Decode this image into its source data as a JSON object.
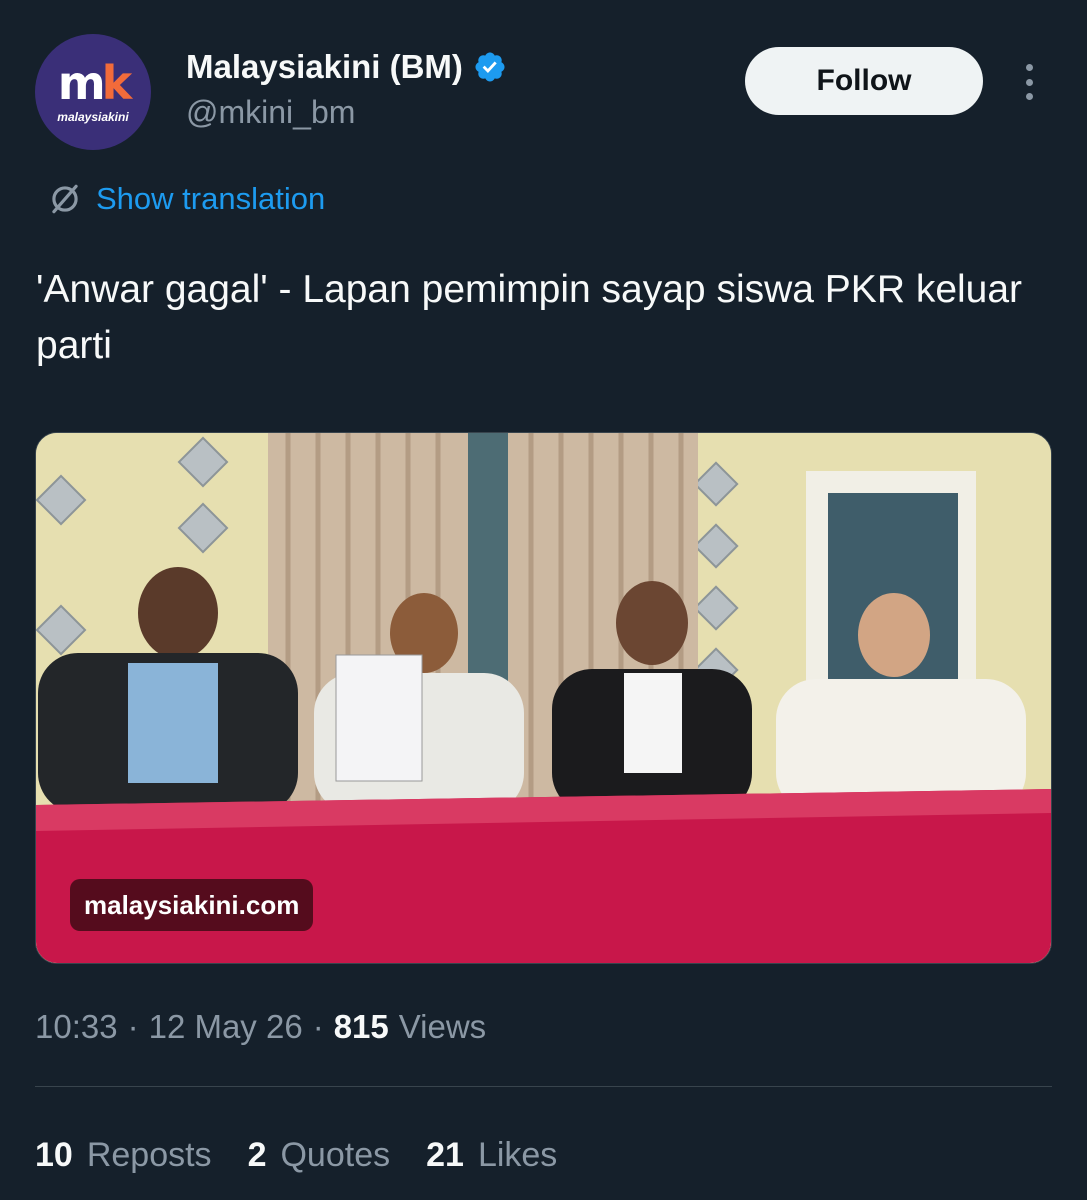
{
  "author": {
    "avatar_logo_m": "m",
    "avatar_logo_k": "k",
    "avatar_wordmark": "malaysiakini",
    "display_name": "Malaysiakini (BM)",
    "handle": "@mkini_bm",
    "verified": true
  },
  "actions": {
    "follow_label": "Follow",
    "translation_label": "Show translation"
  },
  "tweet": {
    "text": "'Anwar gagal' - Lapan pemimpin sayap siswa PKR keluar parti",
    "media_watermark": "malaysiakini.com"
  },
  "meta": {
    "time": "10:33",
    "date": "12 May 26",
    "views_count": "815",
    "views_label": "Views"
  },
  "stats": [
    {
      "count": "10",
      "label": "Reposts"
    },
    {
      "count": "2",
      "label": "Quotes"
    },
    {
      "count": "21",
      "label": "Likes"
    }
  ],
  "colors": {
    "background": "#15202b",
    "accent": "#1d9bf0",
    "muted_text": "#8b98a5",
    "table_cloth": "#c8174a"
  },
  "icons": [
    "verified-badge-icon",
    "more-icon",
    "translate-icon"
  ]
}
